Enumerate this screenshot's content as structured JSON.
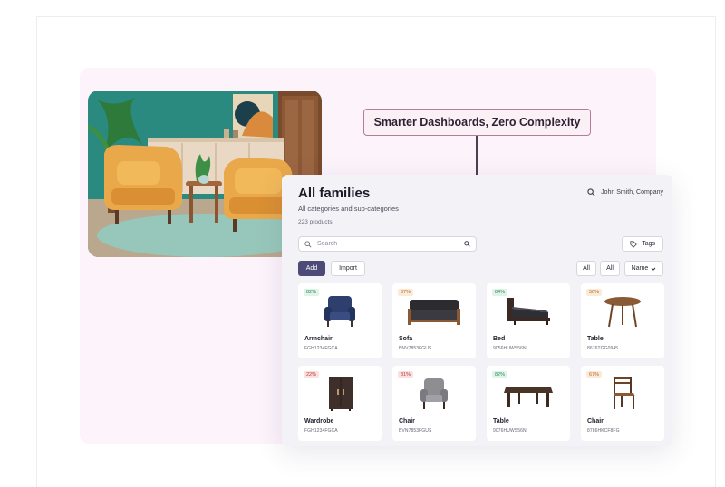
{
  "callout": {
    "text": "Smarter Dashboards, Zero Complexity"
  },
  "dashboard": {
    "title": "All families",
    "subtitle": "All categories and sub-categories",
    "product_count": "223 products",
    "user_name": "John Smith, Company",
    "search_placeholder": "Search",
    "tags_label": "Tags",
    "add_label": "Add",
    "import_label": "Import",
    "filter_all_1": "All",
    "filter_all_2": "All",
    "sort_label": "Name",
    "products": [
      {
        "name": "Armchair",
        "sku": "FGH1234FGCA",
        "badge": "82%",
        "badge_color": "green",
        "icon": "armchair-icon"
      },
      {
        "name": "Sofa",
        "sku": "BNV7853FGUS",
        "badge": "37%",
        "badge_color": "orange",
        "icon": "sofa-icon"
      },
      {
        "name": "Bed",
        "sku": "9056HUWS56N",
        "badge": "84%",
        "badge_color": "green",
        "icon": "bed-icon"
      },
      {
        "name": "Table",
        "sku": "8676TGG0945",
        "badge": "56%",
        "badge_color": "orange",
        "icon": "round-table-icon"
      },
      {
        "name": "Wardrobe",
        "sku": "FGH1234FGCA",
        "badge": "22%",
        "badge_color": "red",
        "icon": "wardrobe-icon"
      },
      {
        "name": "Chair",
        "sku": "BVN7853FGUS",
        "badge": "31%",
        "badge_color": "red",
        "icon": "chair-icon"
      },
      {
        "name": "Table",
        "sku": "9076HUWS56N",
        "badge": "82%",
        "badge_color": "green",
        "icon": "coffee-table-icon"
      },
      {
        "name": "Chair",
        "sku": "8786HKCF8FG",
        "badge": "67%",
        "badge_color": "orange",
        "icon": "wooden-chair-icon"
      }
    ]
  },
  "colors": {
    "accent": "#4e4a78",
    "callout_border": "#b77c95",
    "background_tint": "#fcf3fb"
  }
}
